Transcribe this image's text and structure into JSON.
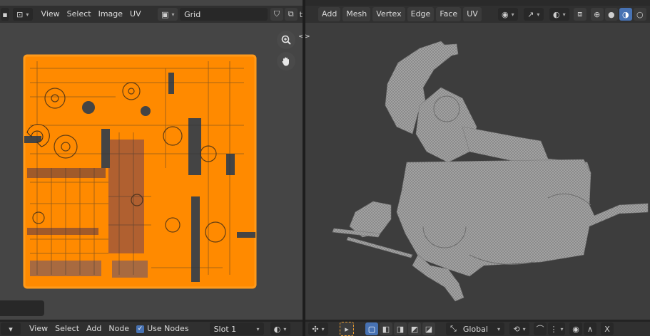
{
  "uv_editor": {
    "menu": [
      "View",
      "Select",
      "Image",
      "UV"
    ],
    "image_name": "Grid"
  },
  "viewport": {
    "menu": [
      "Add",
      "Mesh",
      "Vertex",
      "Edge",
      "Face",
      "UV"
    ],
    "transform_orientation": "Global"
  },
  "node_editor": {
    "menu": [
      "View",
      "Select",
      "Add",
      "Node"
    ],
    "use_nodes_label": "Use Nodes",
    "use_nodes_checked": true,
    "slot": "Slot 1"
  },
  "colors": {
    "accent": "#4772b3",
    "uv_island": "#ff8a00",
    "uv_island_dark": "#e37100",
    "mesh": "#8f8f8f",
    "viewport_bg": "#3d3d3d",
    "uv_bg": "#444444"
  }
}
